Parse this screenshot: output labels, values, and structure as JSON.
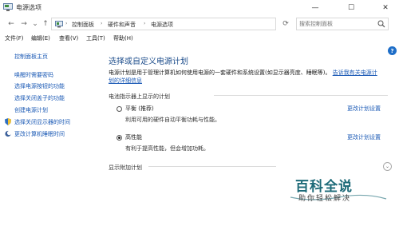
{
  "window": {
    "title": "电源选项",
    "minimize": "—",
    "maximize": "☐",
    "close": "✕"
  },
  "nav": {
    "back": "←",
    "forward": "→",
    "recent": "⌄",
    "up": "↑",
    "refresh": "⟳"
  },
  "address": {
    "crumbs": [
      "控制面板",
      "硬件和声音",
      "电源选项"
    ],
    "separator": "›"
  },
  "search": {
    "placeholder": "搜索控制面板"
  },
  "menu": [
    "文件(F)",
    "编辑(E)",
    "查看(V)",
    "工具(T)",
    "帮助(H)"
  ],
  "help_icon": "?",
  "sidebar": {
    "home": "控制面板主页",
    "items": [
      "唤醒时需要密码",
      "选择电源按钮的功能",
      "选择关闭盖子的功能",
      "创建电源计划",
      "选择关闭显示器的时间",
      "更改计算机睡眠时间"
    ]
  },
  "main": {
    "heading": "选择或自定义电源计划",
    "description": "电源计划是用于管理计算机如何使用电源的一套硬件和系统设置(如显示器亮度、睡眠等)。",
    "desc_link": "告诉我有关电源计划的详细信息",
    "section_label": "电池指示器上显示的计划",
    "plans": [
      {
        "name": "平衡 (推荐)",
        "desc": "利用可用的硬件自动平衡功耗与性能。",
        "change": "更改计划设置",
        "selected": false
      },
      {
        "name": "高性能",
        "desc": "有利于提高性能，但会增加功耗。",
        "change": "更改计划设置",
        "selected": true
      }
    ],
    "additional": "显示附加计划",
    "expand": "⌄"
  },
  "watermark": {
    "title": "百科全说",
    "subtitle": "助你轻松解决"
  },
  "colors": {
    "link": "#1a59b5",
    "heading": "#1e4e8c",
    "watermark": "#1d6a78"
  }
}
